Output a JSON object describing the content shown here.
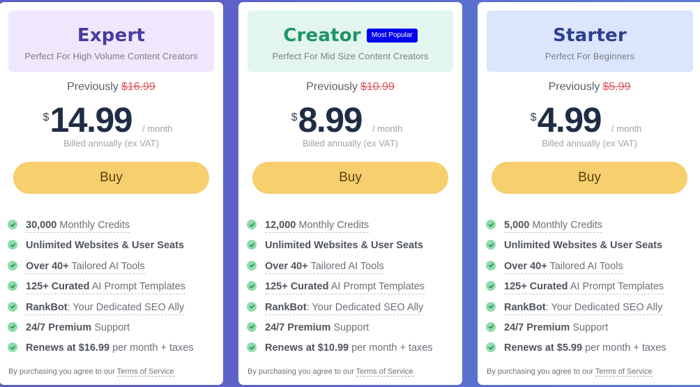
{
  "colors": {
    "expert_title": "#4a3b9e",
    "expert_head_bg": "#efe7fc",
    "creator_title": "#1e9464",
    "creator_head_bg": "#e3f5ef",
    "starter_title": "#2c3f8f",
    "starter_head_bg": "#dbe5fb",
    "buy_button_bg": "#f6cf6e",
    "badge_bg": "#0000ee",
    "old_price": "#e0535b",
    "check_icon": "#8fdcab"
  },
  "plans": [
    {
      "name": "Expert",
      "subtitle": "Perfect For High Volume Content Creators",
      "badge": null,
      "previously_label": "Previously",
      "old_price": "$16.99",
      "currency": "$",
      "price": "14.99",
      "period": "/ month",
      "billing_note": "Billed annually (ex VAT)",
      "buy_label": "Buy",
      "features": [
        {
          "bold": "30,000",
          "rest": " Monthly Credits",
          "dotted": true
        },
        {
          "bold": "Unlimited Websites & User Seats",
          "rest": "",
          "dotted": false
        },
        {
          "bold": "Over 40+",
          "rest": " Tailored AI Tools",
          "dotted": true
        },
        {
          "bold": "125+ Curated",
          "rest": " AI Prompt Templates",
          "dotted": true
        },
        {
          "bold": "RankBot",
          "rest": ": Your Dedicated SEO Ally",
          "dotted": true
        },
        {
          "bold": "24/7 Premium",
          "rest": " Support",
          "dotted": false
        },
        {
          "bold": "Renews at $16.99",
          "rest": " per month + taxes",
          "dotted": false
        }
      ],
      "terms_prefix": "By purchasing you agree to our ",
      "terms_link": "Terms of Service"
    },
    {
      "name": "Creator",
      "subtitle": "Perfect For Mid Size Content Creators",
      "badge": "Most Popular",
      "previously_label": "Previously",
      "old_price": "$10.99",
      "currency": "$",
      "price": "8.99",
      "period": "/ month",
      "billing_note": "Billed annually (ex VAT)",
      "buy_label": "Buy",
      "features": [
        {
          "bold": "12,000",
          "rest": " Monthly Credits",
          "dotted": true
        },
        {
          "bold": "Unlimited Websites & User Seats",
          "rest": "",
          "dotted": false
        },
        {
          "bold": "Over 40+",
          "rest": " Tailored AI Tools",
          "dotted": true
        },
        {
          "bold": "125+ Curated",
          "rest": " AI Prompt Templates",
          "dotted": true
        },
        {
          "bold": "RankBot",
          "rest": ": Your Dedicated SEO Ally",
          "dotted": true
        },
        {
          "bold": "24/7 Premium",
          "rest": " Support",
          "dotted": false
        },
        {
          "bold": "Renews at $10.99",
          "rest": " per month + taxes",
          "dotted": false
        }
      ],
      "terms_prefix": "By purchasing you agree to our ",
      "terms_link": "Terms of Service"
    },
    {
      "name": "Starter",
      "subtitle": "Perfect For Beginners",
      "badge": null,
      "previously_label": "Previously",
      "old_price": "$5.99",
      "currency": "$",
      "price": "4.99",
      "period": "/ month",
      "billing_note": "Billed annually (ex VAT)",
      "buy_label": "Buy",
      "features": [
        {
          "bold": "5,000",
          "rest": " Monthly Credits",
          "dotted": true
        },
        {
          "bold": "Unlimited Websites & User Seats",
          "rest": "",
          "dotted": false
        },
        {
          "bold": "Over 40+",
          "rest": " Tailored AI Tools",
          "dotted": true
        },
        {
          "bold": "125+ Curated",
          "rest": " AI Prompt Templates",
          "dotted": true
        },
        {
          "bold": "RankBot",
          "rest": ": Your Dedicated SEO Ally",
          "dotted": true
        },
        {
          "bold": "24/7 Premium",
          "rest": " Support",
          "dotted": false
        },
        {
          "bold": "Renews at $5.99",
          "rest": " per month + taxes",
          "dotted": false
        }
      ],
      "terms_prefix": "By purchasing you agree to our ",
      "terms_link": "Terms of Service"
    }
  ]
}
